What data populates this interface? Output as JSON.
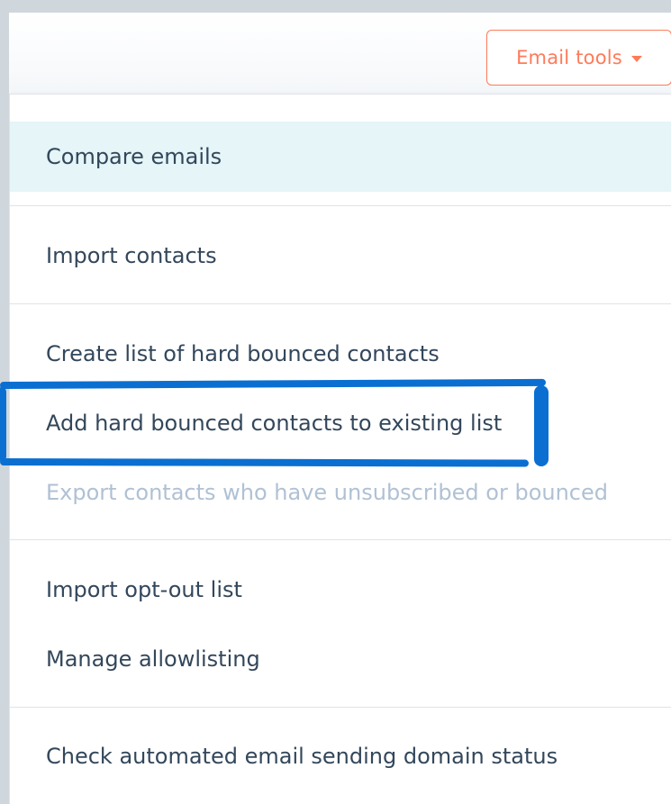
{
  "toolbar": {
    "email_tools_label": "Email tools"
  },
  "menu": {
    "items": [
      "Compare emails",
      "Import contacts",
      "Create list of hard bounced contacts",
      "Add hard bounced contacts to existing list",
      "Export contacts who have unsubscribed or bounced",
      "Import opt-out list",
      "Manage allowlisting",
      "Check automated email sending domain status"
    ]
  },
  "colors": {
    "accent": "#ff7a59",
    "text": "#33475b",
    "muted": "#b0c1d4",
    "active_bg": "#e5f5f8",
    "annotation": "#0a6fd1"
  }
}
